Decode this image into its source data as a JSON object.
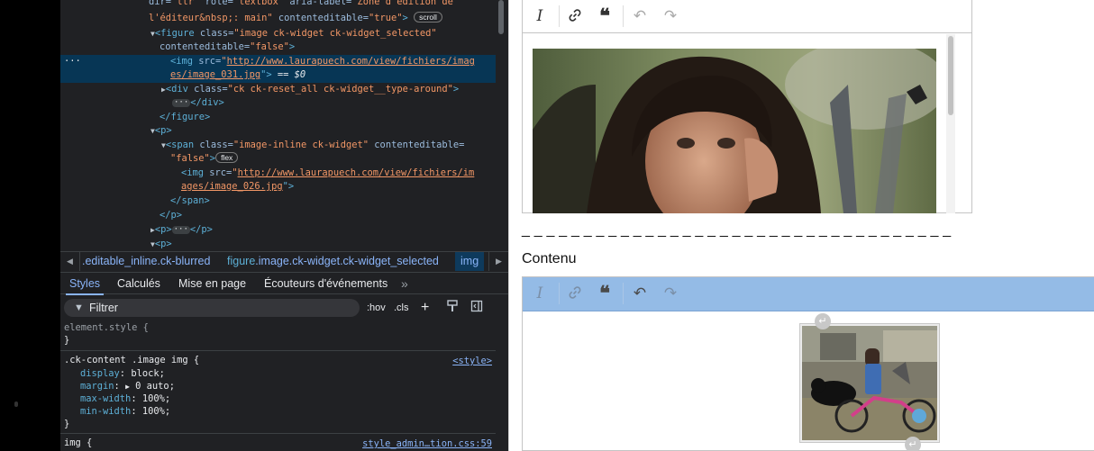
{
  "dom_tree": {
    "line0": {
      "pre": "dir=",
      "v1": "\"ltr\"",
      "a2": " role=",
      "v2": "\"textbox\"",
      "a3": " aria-label=",
      "v3": "\"Zone d'édition de"
    },
    "line1": {
      "v": "l'éditeur&nbsp;: main\"",
      "a": " contenteditable=",
      "v2": "\"true\"",
      "badge": "scroll"
    },
    "line2": {
      "tag": "<figure",
      "a": " class=",
      "v": "\"image ck-widget ck-widget_selected\""
    },
    "line3": {
      "a": "contenteditable=",
      "v": "\"false\"",
      "close": ">"
    },
    "line4": {
      "tag": "<img",
      "a": " src=",
      "link": "http://www.laurapuech.com/view/fichiers/imag"
    },
    "line5": {
      "link": "es/image_031.jpg",
      "close": "\">",
      "eq": " == ",
      "dollar": "$0"
    },
    "line6": {
      "tag": "<div",
      "a": " class=",
      "v": "\"ck ck-reset_all ck-widget__type-around\"",
      "close": ">"
    },
    "line7": {
      "ell": "···",
      "close": "</div>"
    },
    "line8": {
      "close": "</figure>"
    },
    "line9": {
      "tag": "<p>"
    },
    "line10": {
      "tag": "<span",
      "a": " class=",
      "v": "\"image-inline ck-widget\"",
      "a2": " contenteditable="
    },
    "line11": {
      "v": "\"false\"",
      "close": ">",
      "badge": "flex"
    },
    "line12": {
      "tag": "<img",
      "a": " src=",
      "link": "http://www.laurapuech.com/view/fichiers/im"
    },
    "line13": {
      "link": "ages/image_026.jpg",
      "close": "\">"
    },
    "line14": {
      "close": "</span>"
    },
    "line15": {
      "close": "</p>"
    },
    "line16": {
      "tag": "<p>",
      "ell": "···",
      "close": "</p>"
    },
    "line17": {
      "tag": "<p>"
    },
    "selected_marker": "···"
  },
  "breadcrumbs": {
    "items": [
      ".editable_inline.ck-blurred",
      "figure.image.ck-widget.ck-widget_selected",
      "img"
    ]
  },
  "panel_tabs": [
    "Styles",
    "Calculés",
    "Mise en page",
    "Écouteurs d'événements"
  ],
  "filter": {
    "placeholder": "Filtrer",
    "hov": ":hov",
    "cls": ".cls"
  },
  "styles": {
    "element_style": "element.style {",
    "element_style_close": "}",
    "rule1_selector": ".ck-content .image img {",
    "rule1_source": "<style>",
    "rule1_props": [
      {
        "p": "display",
        "v": "block;"
      },
      {
        "p": "margin",
        "v": "0 auto;"
      },
      {
        "p": "max-width",
        "v": "100%;"
      },
      {
        "p": "min-width",
        "v": "100%;"
      }
    ],
    "rule1_close": "}",
    "rule2_selector": "img {",
    "rule2_source": "style_admin…tion.css:59"
  },
  "editor1": {
    "toolbar": {
      "italic": "I",
      "link": "link-icon",
      "quote": "blockquote-icon",
      "undo": "undo-icon",
      "redo": "redo-icon"
    }
  },
  "separator_text": "_ _ _ _ _ _ _ _ _ _ _ _ _ _ _ _ _ _ _ _ _ _ _ _ _ _ _ _ _ _ _ _ _ _ _",
  "label_contenu": "Contenu",
  "editor2": {
    "toolbar_color": "#94bbe6"
  }
}
